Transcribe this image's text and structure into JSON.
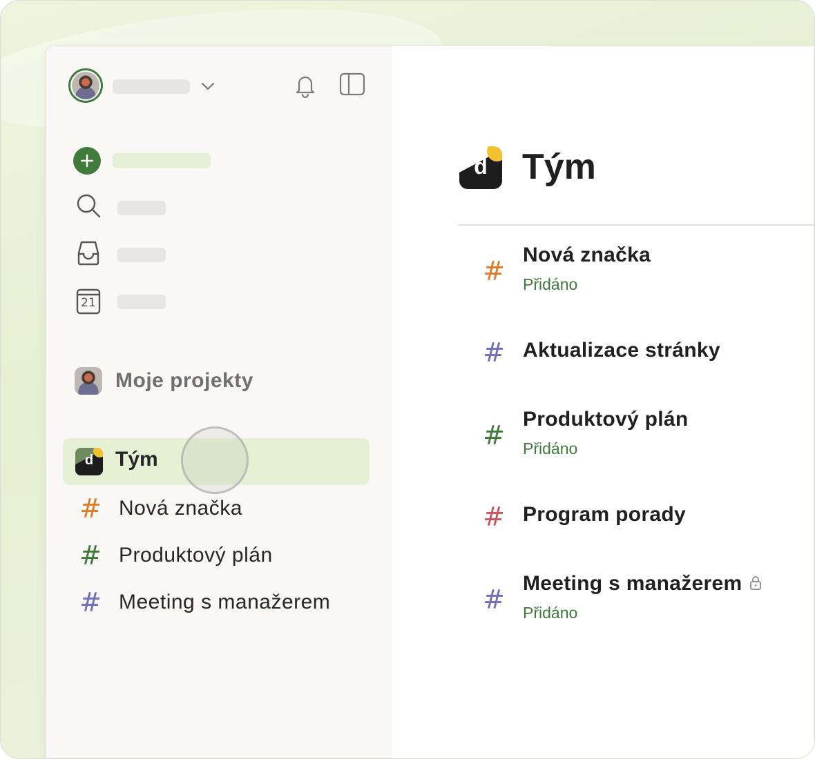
{
  "sidebar": {
    "my_projects_label": "Moje projekty",
    "team": {
      "label": "Tým",
      "logo_letter": "d"
    },
    "projects": [
      {
        "label": "Nová značka",
        "color": "#e07b2a"
      },
      {
        "label": "Produktový plán",
        "color": "#3f7b3b"
      },
      {
        "label": "Meeting s manažerem",
        "color": "#6f6fb8"
      }
    ]
  },
  "main": {
    "title": "Tým",
    "logo_letter": "d",
    "items": [
      {
        "hash": "#",
        "title": "Nová značka",
        "sub": "Přidáno",
        "color": "#e07b2a",
        "locked": false
      },
      {
        "hash": "#",
        "title": "Aktualizace stránky",
        "sub": "",
        "color": "#6f6fb8",
        "locked": false
      },
      {
        "hash": "#",
        "title": "Produktový plán",
        "sub": "Přidáno",
        "color": "#3f7b3b",
        "locked": false
      },
      {
        "hash": "#",
        "title": "Program porady",
        "sub": "",
        "color": "#c9555f",
        "locked": false
      },
      {
        "hash": "#",
        "title": "Meeting s manažerem",
        "sub": "Přidáno",
        "color": "#6f6fb8",
        "locked": true
      }
    ]
  },
  "icons": {
    "calendar_day": "21"
  },
  "colors": {
    "accent": "#3f7b3b",
    "highlight": "#e5f0d4"
  }
}
